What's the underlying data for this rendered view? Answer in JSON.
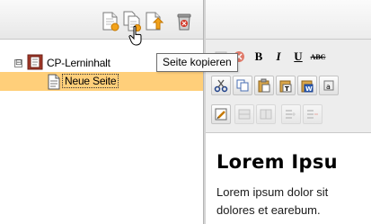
{
  "left_toolbar": {
    "buttons": [
      {
        "icon": "new-page-icon"
      },
      {
        "icon": "copy-page-icon"
      },
      {
        "icon": "move-page-icon"
      },
      {
        "icon": "delete-page-icon"
      }
    ]
  },
  "tree": {
    "root": {
      "label": "CP-Lerninhalt",
      "expander": "⊟",
      "icon": "book-icon"
    },
    "children": [
      {
        "label": "Neue Seite",
        "icon": "page-icon",
        "selected": true
      }
    ]
  },
  "tooltip": {
    "text": "Seite kopieren"
  },
  "editor": {
    "toolbar_labels": {
      "bold": "B",
      "italic": "I",
      "underline": "U",
      "strike": "ABC"
    },
    "content": {
      "heading": "Lorem Ipsu",
      "line1": "Lorem ipsum dolor sit",
      "line2": "dolores et earebum."
    }
  },
  "colors": {
    "selection": "#ffcf7a",
    "accent_orange": "#f2a21a",
    "delete_red": "#d23a2a"
  }
}
